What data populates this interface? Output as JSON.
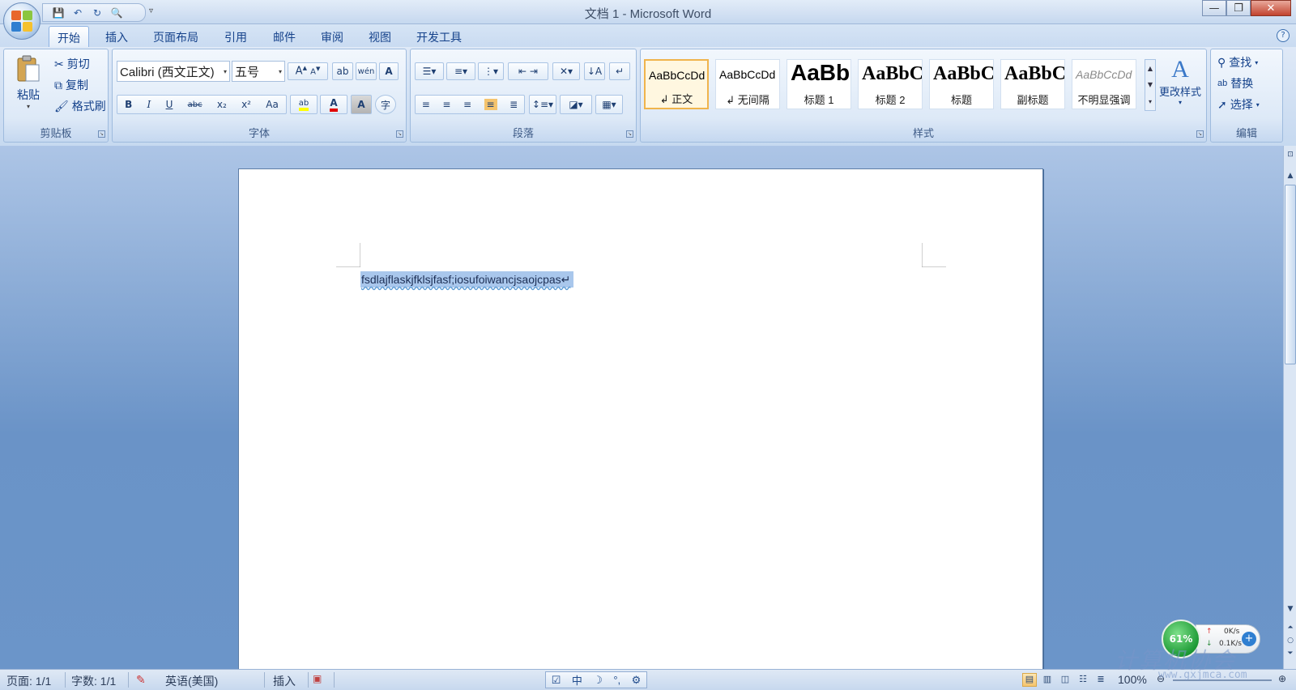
{
  "app": {
    "title": "文档 1 - Microsoft Word"
  },
  "quick_access": {
    "save": "💾",
    "undo": "↶",
    "redo": "↻",
    "preview": "🔍",
    "more": "▿"
  },
  "window_controls": {
    "minimize": "—",
    "maximize": "❐",
    "close": "✕"
  },
  "tabs": [
    "开始",
    "插入",
    "页面布局",
    "引用",
    "邮件",
    "审阅",
    "视图",
    "开发工具"
  ],
  "help": "?",
  "clipboard": {
    "paste": "粘贴",
    "cut": "剪切",
    "copy": "复制",
    "format_painter": "格式刷",
    "group": "剪贴板"
  },
  "font": {
    "name": "Calibri (西文正文)",
    "size": "五号",
    "group": "字体",
    "buttons": {
      "grow": "A",
      "shrink": "A",
      "clear": "ab",
      "phonetic": "wén",
      "border": "A",
      "bold": "B",
      "italic": "I",
      "underline": "U",
      "strike": "abc",
      "sub": "x₂",
      "sup": "x²",
      "case": "Aa",
      "highlight": "ab",
      "color": "A",
      "shade": "A",
      "enclose": "字"
    }
  },
  "paragraph": {
    "group": "段落"
  },
  "styles": {
    "group": "样式",
    "change": "更改样式",
    "items": [
      {
        "sample": "AaBbCcDd",
        "name": "↲ 正文"
      },
      {
        "sample": "AaBbCcDd",
        "name": "↲ 无间隔"
      },
      {
        "sample": "AaBb",
        "name": "标题 1"
      },
      {
        "sample": "AaBbC",
        "name": "标题 2"
      },
      {
        "sample": "AaBbC",
        "name": "标题"
      },
      {
        "sample": "AaBbC",
        "name": "副标题"
      },
      {
        "sample": "AaBbCcDd",
        "name": "不明显强调"
      }
    ]
  },
  "editing": {
    "group": "编辑",
    "find": "查找",
    "replace": "替换",
    "select": "选择"
  },
  "document": {
    "text": "fsdlajflaskjfklsjfasf;iosufoiwancjsaojcpas↵"
  },
  "status": {
    "page": "页面: 1/1",
    "words": "字数: 1/1",
    "language": "英语(美国)",
    "mode": "插入",
    "zoom": "100%",
    "ime_mode": "中"
  },
  "widget": {
    "percent": "61%",
    "up": "0K/s",
    "down": "0.1K/s"
  },
  "watermark": {
    "text": "计算机协会",
    "url": "www.gxjmca.com"
  },
  "colors": {
    "accent": "#15428b",
    "highlight": "#ffff00",
    "font_color": "#e00000",
    "selection": "#a9c7ec"
  }
}
